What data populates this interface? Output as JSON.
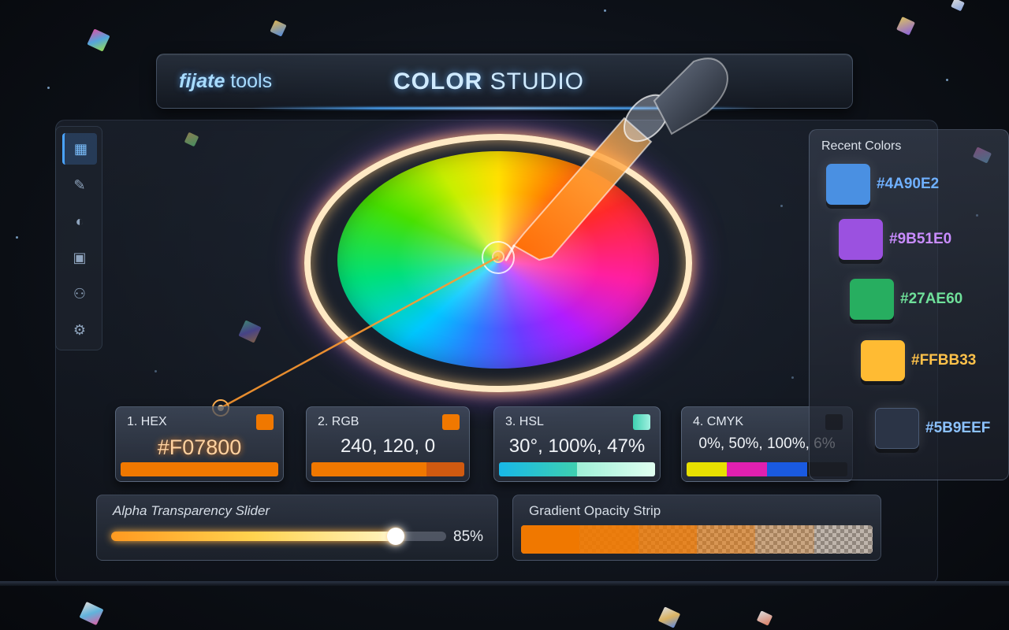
{
  "header": {
    "brand_bold": "fijate",
    "brand_rest": " tools",
    "title_bold": "COLOR",
    "title_rest": " STUDIO"
  },
  "sidebar": {
    "items": [
      {
        "icon": "grid-icon",
        "active": true
      },
      {
        "icon": "brush-icon",
        "active": false
      },
      {
        "icon": "palette-icon",
        "active": false
      },
      {
        "icon": "image-icon",
        "active": false
      },
      {
        "icon": "user-icon",
        "active": false
      },
      {
        "icon": "gear-icon",
        "active": false
      }
    ]
  },
  "formats": {
    "hex": {
      "label": "1. HEX",
      "value": "#F07800",
      "swatch": "#F07800"
    },
    "rgb": {
      "label": "2. RGB",
      "value": "240, 120, 0",
      "swatch": "#F07800"
    },
    "hsl": {
      "label": "3. HSL",
      "value": "30°, 100%, 47%",
      "swatch": "#3ED0B0"
    },
    "cmyk": {
      "label": "4. CMYK",
      "value": "0%, 50%, 100%, 6%",
      "swatch": "#111111"
    }
  },
  "alpha": {
    "label": "Alpha Transparency Slider",
    "value_text": "85%",
    "value": 0.85
  },
  "gradient": {
    "label": "Gradient Opacity Strip"
  },
  "recent": {
    "title": "Recent Colors",
    "colors": [
      {
        "hex": "#4A90E2",
        "color": "#4A90E2"
      },
      {
        "hex": "#9B51E0",
        "color": "#9B51E0"
      },
      {
        "hex": "#27AE60",
        "color": "#27AE60"
      },
      {
        "hex": "#FFBB33",
        "color": "#FFBB33"
      },
      {
        "hex": "#5B9EEF",
        "color": "#2B3446"
      }
    ]
  },
  "colors": {
    "accent": "#F07800",
    "glow_blue": "#4AA3FF"
  }
}
